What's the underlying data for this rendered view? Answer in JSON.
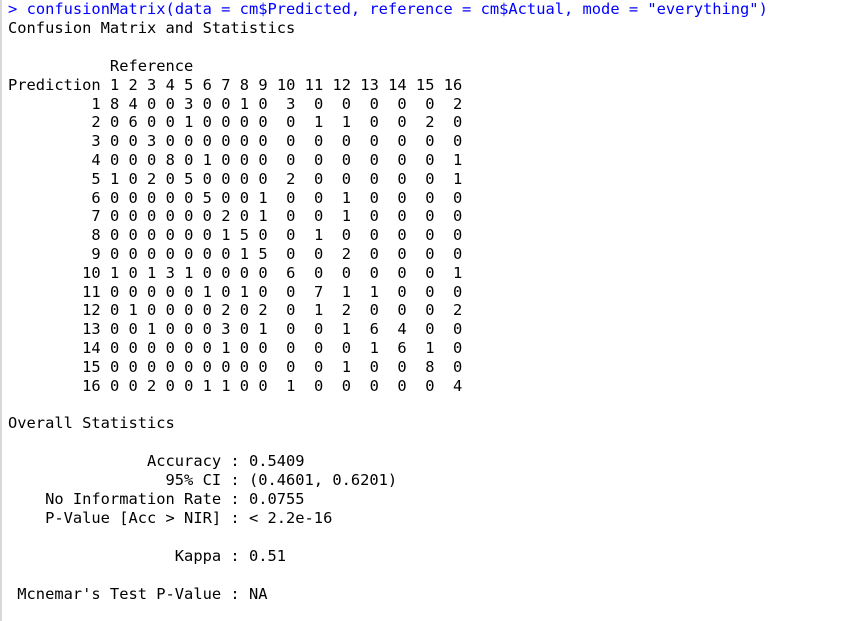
{
  "console": {
    "prompt": ">",
    "command": "confusionMatrix(data = cm$Predicted, reference = cm$Actual, mode = \"everything\")",
    "heading": "Confusion Matrix and Statistics",
    "colors": {
      "command": "#0000ff",
      "output": "#000000",
      "background": "#ffffff"
    }
  },
  "matrix": {
    "reference_label": "Reference",
    "prediction_label": "Prediction",
    "columns": [
      "1",
      "2",
      "3",
      "4",
      "5",
      "6",
      "7",
      "8",
      "9",
      "10",
      "11",
      "12",
      "13",
      "14",
      "15",
      "16"
    ],
    "rows": [
      {
        "label": "1",
        "values": [
          8,
          4,
          0,
          0,
          3,
          0,
          0,
          1,
          0,
          3,
          0,
          0,
          0,
          0,
          0,
          2
        ]
      },
      {
        "label": "2",
        "values": [
          0,
          6,
          0,
          0,
          1,
          0,
          0,
          0,
          0,
          0,
          1,
          1,
          0,
          0,
          2,
          0
        ]
      },
      {
        "label": "3",
        "values": [
          0,
          0,
          3,
          0,
          0,
          0,
          0,
          0,
          0,
          0,
          0,
          0,
          0,
          0,
          0,
          0
        ]
      },
      {
        "label": "4",
        "values": [
          0,
          0,
          0,
          8,
          0,
          1,
          0,
          0,
          0,
          0,
          0,
          0,
          0,
          0,
          0,
          1
        ]
      },
      {
        "label": "5",
        "values": [
          1,
          0,
          2,
          0,
          5,
          0,
          0,
          0,
          0,
          2,
          0,
          0,
          0,
          0,
          0,
          1
        ]
      },
      {
        "label": "6",
        "values": [
          0,
          0,
          0,
          0,
          0,
          5,
          0,
          0,
          1,
          0,
          0,
          1,
          0,
          0,
          0,
          0
        ]
      },
      {
        "label": "7",
        "values": [
          0,
          0,
          0,
          0,
          0,
          0,
          2,
          0,
          1,
          0,
          0,
          1,
          0,
          0,
          0,
          0
        ]
      },
      {
        "label": "8",
        "values": [
          0,
          0,
          0,
          0,
          0,
          0,
          1,
          5,
          0,
          0,
          1,
          0,
          0,
          0,
          0,
          0
        ]
      },
      {
        "label": "9",
        "values": [
          0,
          0,
          0,
          0,
          0,
          0,
          0,
          1,
          5,
          0,
          0,
          2,
          0,
          0,
          0,
          0
        ]
      },
      {
        "label": "10",
        "values": [
          1,
          0,
          1,
          3,
          1,
          0,
          0,
          0,
          0,
          6,
          0,
          0,
          0,
          0,
          0,
          1
        ]
      },
      {
        "label": "11",
        "values": [
          0,
          0,
          0,
          0,
          0,
          1,
          0,
          1,
          0,
          0,
          7,
          1,
          1,
          0,
          0,
          0
        ]
      },
      {
        "label": "12",
        "values": [
          0,
          1,
          0,
          0,
          0,
          0,
          2,
          0,
          2,
          0,
          1,
          2,
          0,
          0,
          0,
          2
        ]
      },
      {
        "label": "13",
        "values": [
          0,
          0,
          1,
          0,
          0,
          0,
          3,
          0,
          1,
          0,
          0,
          1,
          6,
          4,
          0,
          0
        ]
      },
      {
        "label": "14",
        "values": [
          0,
          0,
          0,
          0,
          0,
          0,
          1,
          0,
          0,
          0,
          0,
          0,
          1,
          6,
          1,
          0
        ]
      },
      {
        "label": "15",
        "values": [
          0,
          0,
          0,
          0,
          0,
          0,
          0,
          0,
          0,
          0,
          0,
          1,
          0,
          0,
          8,
          0
        ]
      },
      {
        "label": "16",
        "values": [
          0,
          0,
          2,
          0,
          0,
          1,
          1,
          0,
          0,
          1,
          0,
          0,
          0,
          0,
          0,
          4
        ]
      }
    ]
  },
  "overall": {
    "heading": "Overall Statistics",
    "stats": [
      {
        "label": "Accuracy",
        "value": "0.5409"
      },
      {
        "label": "95% CI",
        "value": "(0.4601, 0.6201)"
      },
      {
        "label": "No Information Rate",
        "value": "0.0755"
      },
      {
        "label": "P-Value [Acc > NIR]",
        "value": "< 2.2e-16"
      },
      {
        "label": "",
        "value": ""
      },
      {
        "label": "Kappa",
        "value": "0.51"
      },
      {
        "label": "",
        "value": ""
      },
      {
        "label": "Mcnemar's Test P-Value",
        "value": "NA"
      }
    ]
  }
}
